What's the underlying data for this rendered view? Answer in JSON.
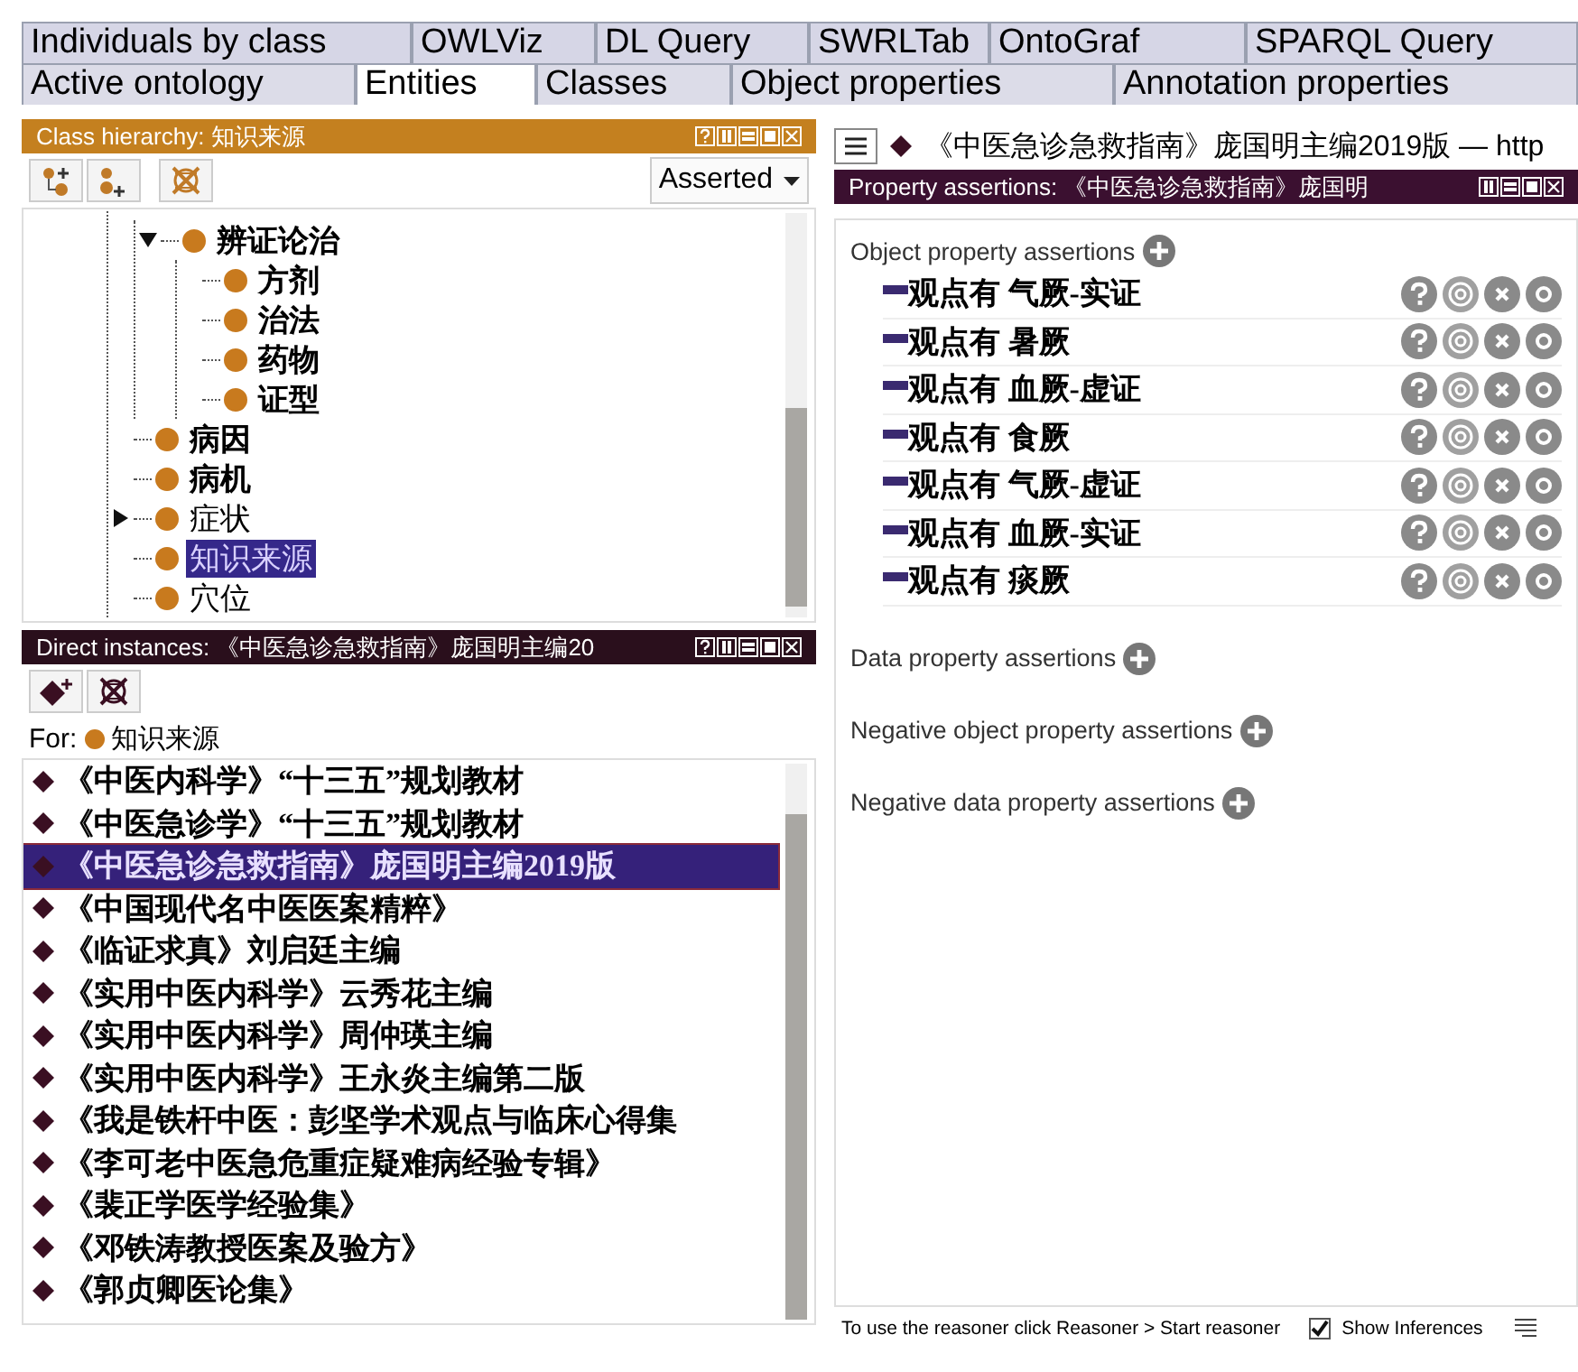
{
  "tabs_top": [
    {
      "label": "Individuals by class",
      "selected": false
    },
    {
      "label": "OWLViz",
      "selected": false
    },
    {
      "label": "DL Query",
      "selected": false
    },
    {
      "label": "SWRLTab",
      "selected": false
    },
    {
      "label": "OntoGraf",
      "selected": false
    },
    {
      "label": "SPARQL Query",
      "selected": false
    }
  ],
  "tabs_bottom": [
    {
      "label": "Active ontology",
      "selected": false
    },
    {
      "label": "Entities",
      "selected": true
    },
    {
      "label": "Classes",
      "selected": false
    },
    {
      "label": "Object properties",
      "selected": false
    },
    {
      "label": "Annotation properties",
      "selected": false
    }
  ],
  "class_hierarchy": {
    "title": "Class hierarchy: 知识来源",
    "mode": "Asserted",
    "tree": [
      {
        "children": [
          {
            "label": "辨证论治",
            "bold": true,
            "selected": false,
            "expanded": true,
            "children": [
              {
                "label": "方剂",
                "bold": true,
                "selected": false
              },
              {
                "label": "治法",
                "bold": true,
                "selected": false
              },
              {
                "label": "药物",
                "bold": true,
                "selected": false
              },
              {
                "label": "证型",
                "bold": true,
                "selected": false
              }
            ]
          }
        ]
      },
      {
        "label": "病因",
        "bold": true,
        "selected": false
      },
      {
        "label": "病机",
        "bold": true,
        "selected": false
      },
      {
        "label": "症状",
        "bold": false,
        "selected": false,
        "expanded": false
      },
      {
        "label": "知识来源",
        "bold": false,
        "selected": true
      },
      {
        "label": "穴位",
        "bold": false,
        "selected": false
      }
    ]
  },
  "direct_instances": {
    "title": "Direct instances: 《中医急诊急救指南》庞国明主编20",
    "for_label": "For:",
    "for_class": "知识来源",
    "items": [
      {
        "label": "《中医内科学》“十三五”规划教材",
        "selected": false
      },
      {
        "label": "《中医急诊学》“十三五”规划教材",
        "selected": false
      },
      {
        "label": "《中医急诊急救指南》庞国明主编2019版",
        "selected": true
      },
      {
        "label": "《中国现代名中医医案精粹》",
        "selected": false
      },
      {
        "label": "《临证求真》刘启廷主编",
        "selected": false
      },
      {
        "label": "《实用中医内科学》云秀花主编",
        "selected": false
      },
      {
        "label": "《实用中医内科学》周仲瑛主编",
        "selected": false
      },
      {
        "label": "《实用中医内科学》王永炎主编第二版",
        "selected": false
      },
      {
        "label": "《我是铁杆中医：彭坚学术观点与临床心得集",
        "selected": false
      },
      {
        "label": "《李可老中医急危重症疑难病经验专辑》",
        "selected": false
      },
      {
        "label": "《裴正学医学经验集》",
        "selected": false
      },
      {
        "label": "《邓铁涛教授医案及验方》",
        "selected": false
      },
      {
        "label": "《郭贞卿医论集》",
        "selected": false
      }
    ]
  },
  "individual_title": "《中医急诊急救指南》庞国明主编2019版 — http",
  "property_assertions": {
    "title": "Property assertions: 《中医急诊急救指南》庞国明",
    "sections": [
      {
        "title": "Object property assertions",
        "rows": [
          {
            "property": "观点有",
            "value": "气厥-实证"
          },
          {
            "property": "观点有",
            "value": "暑厥"
          },
          {
            "property": "观点有",
            "value": "血厥-虚证"
          },
          {
            "property": "观点有",
            "value": "食厥"
          },
          {
            "property": "观点有",
            "value": "气厥-虚证"
          },
          {
            "property": "观点有",
            "value": "血厥-实证"
          },
          {
            "property": "观点有",
            "value": "痰厥"
          }
        ]
      },
      {
        "title": "Data property assertions"
      },
      {
        "title": "Negative object property assertions"
      },
      {
        "title": "Negative data property assertions"
      }
    ]
  },
  "status_bar": {
    "message": "To use the reasoner click Reasoner > Start reasoner",
    "show_inferences": {
      "label": "Show Inferences",
      "checked": true
    }
  }
}
